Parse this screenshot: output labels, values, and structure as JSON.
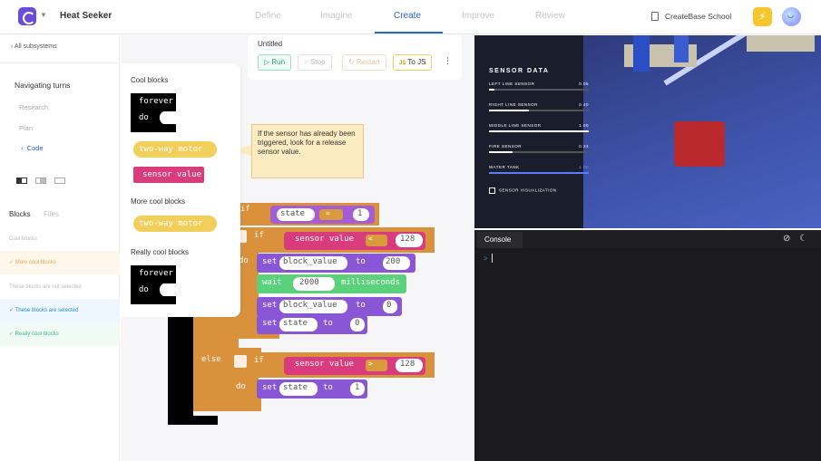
{
  "header": {
    "app_name": "Heat Seeker",
    "tabs": [
      {
        "label": "Define",
        "active": false
      },
      {
        "label": "Imagine",
        "active": false
      },
      {
        "label": "Create",
        "active": true
      },
      {
        "label": "Improve",
        "active": false
      },
      {
        "label": "Review",
        "active": false
      }
    ],
    "school": "CreateBase School",
    "accent": "#2a66c8"
  },
  "sidebar": {
    "back_label": "All subsystems",
    "section_title": "Navigating turns",
    "nav": [
      {
        "label": "Research",
        "active": false
      },
      {
        "label": "Plan",
        "active": false
      },
      {
        "label": "Code",
        "active": true
      }
    ],
    "tabs": {
      "blocks": "Blocks",
      "files": "Files"
    },
    "rows": [
      {
        "label": "Cool blocks",
        "style": "plain"
      },
      {
        "label": "More cool blocks",
        "style": "orange",
        "check": true
      },
      {
        "label": "These blocks are not selected",
        "style": "plain"
      },
      {
        "label": "These blocks are selected",
        "style": "blue",
        "check": true
      },
      {
        "label": "Really cool blocks",
        "style": "green",
        "check": true
      }
    ]
  },
  "editor": {
    "file_name": "Untitled",
    "buttons": {
      "run": "Run",
      "stop": "Stop",
      "restart": "Restart",
      "tojs_prefix": "JS",
      "tojs": "To JS"
    },
    "flyout": {
      "sections": [
        "Cool blocks",
        "More cool blocks",
        "Really cool blocks"
      ],
      "forever": "forever",
      "do": "do",
      "motor": "two-way motor",
      "sensor": "sensor value"
    },
    "comment": "If the sensor has already been triggered, look for a release sensor value.",
    "code": {
      "if": "if",
      "do": "do",
      "else": "else",
      "state": "state",
      "eq": "=",
      "one": "1",
      "sensor_value": "sensor value",
      "lt": "<",
      "gt": ">",
      "n128": "128",
      "set": "set",
      "block_value": "block_value",
      "to": "to",
      "n200": "200",
      "wait": "wait",
      "n2000": "2000",
      "ms": "milliseconds",
      "zero": "0"
    }
  },
  "simulation": {
    "title": "SENSOR DATA",
    "sensors": [
      {
        "label": "LEFT LINE SENSOR",
        "value": "0.05",
        "fraction": 0.05
      },
      {
        "label": "RIGHT LINE SENSOR",
        "value": "0.40",
        "fraction": 0.4
      },
      {
        "label": "MIDDLE LINE SENSOR",
        "value": "1.00",
        "fraction": 1.0
      },
      {
        "label": "FIRE SENSOR",
        "value": "0.24",
        "fraction": 0.24
      },
      {
        "label": "WATER TANK",
        "value": "1.00",
        "fraction": 1.0,
        "color": "#5a7cff"
      }
    ],
    "checkbox": "SENSOR VISUALIZATION"
  },
  "console": {
    "tab": "Console",
    "prompt": ">"
  }
}
